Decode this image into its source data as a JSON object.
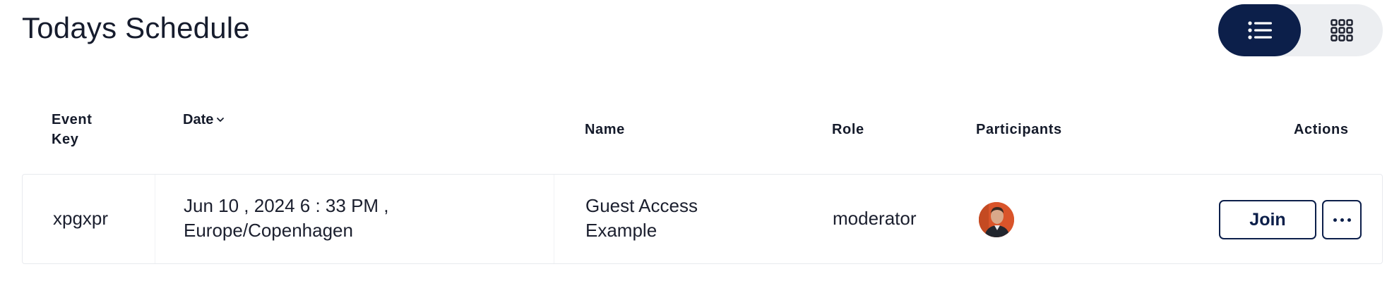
{
  "page": {
    "title": "Todays Schedule"
  },
  "view_toggle": {
    "active": "list",
    "options": [
      {
        "name": "list",
        "icon": "list-icon"
      },
      {
        "name": "grid",
        "icon": "grid-icon"
      }
    ],
    "active_bg": "#0c1f4a",
    "track_bg": "#eceef1"
  },
  "table": {
    "headers": {
      "event_key": "Event Key",
      "date": "Date",
      "date_sort_icon": "chevron-down-icon",
      "name": "Name",
      "role": "Role",
      "participants": "Participants",
      "actions": "Actions"
    },
    "rows": [
      {
        "event_key": "xpgxpr",
        "date_line1": "Jun 10 ,  2024 6 : 33 PM ,",
        "date_line2": "Europe/Copenhagen",
        "name_line1": "Guest Access",
        "name_line2": "Example",
        "role": "moderator",
        "participants": [
          {
            "avatar": "avatar-photo"
          }
        ],
        "actions": {
          "join_label": "Join",
          "more_icon": "more-horizontal-icon"
        }
      }
    ]
  },
  "colors": {
    "primary": "#0c1f4a",
    "text": "#1b1f2e",
    "border": "#e8eaee"
  }
}
